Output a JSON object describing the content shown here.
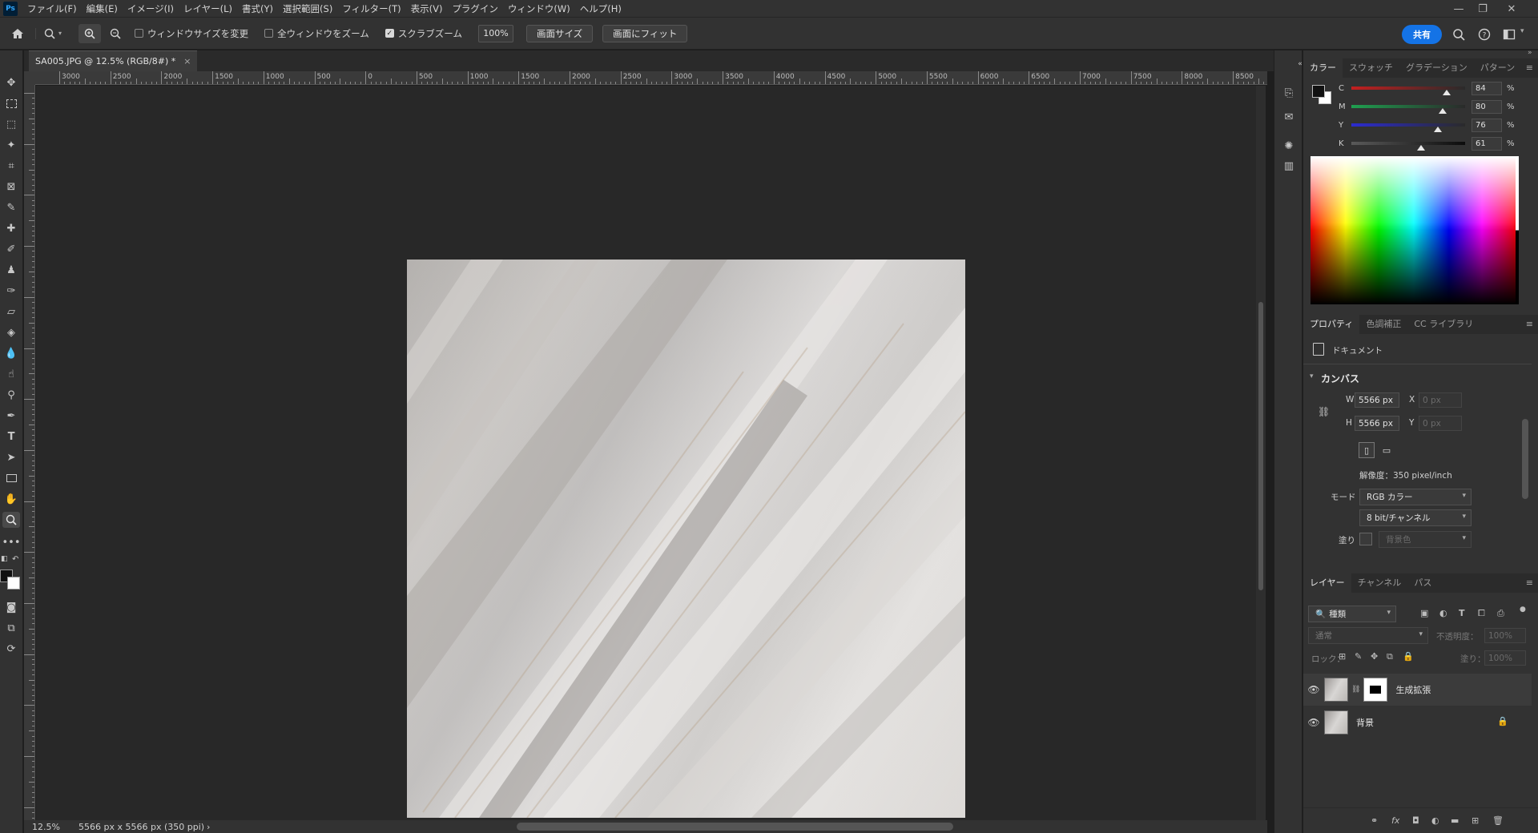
{
  "app": {
    "logo": "Ps"
  },
  "menu": [
    "ファイル(F)",
    "編集(E)",
    "イメージ(I)",
    "レイヤー(L)",
    "書式(Y)",
    "選択範囲(S)",
    "フィルター(T)",
    "表示(V)",
    "プラグイン",
    "ウィンドウ(W)",
    "ヘルプ(H)"
  ],
  "window_controls": {
    "minimize": "—",
    "restore": "❐",
    "close": "✕"
  },
  "options": {
    "resize_windows": {
      "label": "ウィンドウサイズを変更",
      "checked": false
    },
    "zoom_all": {
      "label": "全ウィンドウをズーム",
      "checked": false
    },
    "scrubby_zoom": {
      "label": "スクラブズーム",
      "checked": true
    },
    "zoom_value": "100%",
    "fill_screen_btn": "画面サイズ",
    "fit_screen_btn": "画面にフィット",
    "share": "共有"
  },
  "document": {
    "tab_title": "SA005.JPG @ 12.5% (RGB/8#) *",
    "close": "×"
  },
  "ruler_h_labels": [
    "3000",
    "2500",
    "2000",
    "1500",
    "1000",
    "500",
    "0",
    "500",
    "1000",
    "1500",
    "2000",
    "2500",
    "3000",
    "3500",
    "4000",
    "4500",
    "5000",
    "5500",
    "6000",
    "6500",
    "7000",
    "7500",
    "8000",
    "8500"
  ],
  "status": {
    "zoom": "12.5%",
    "info": "5566 px x 5566 px (350 ppi)",
    "arrow": "›"
  },
  "color_panel": {
    "tabs": [
      "カラー",
      "スウォッチ",
      "グラデーション",
      "パターン"
    ],
    "sliders": [
      {
        "label": "C",
        "value": "84",
        "unit": "%",
        "level": 0.84
      },
      {
        "label": "M",
        "value": "80",
        "unit": "%",
        "level": 0.8
      },
      {
        "label": "Y",
        "value": "76",
        "unit": "%",
        "level": 0.76
      },
      {
        "label": "K",
        "value": "61",
        "unit": "%",
        "level": 0.61
      }
    ]
  },
  "properties_panel": {
    "tabs": [
      "プロパティ",
      "色調補正",
      "CC ライブラリ"
    ],
    "doc_label": "ドキュメント",
    "section": "カンバス",
    "w_label": "W",
    "w_value": "5566 px",
    "h_label": "H",
    "h_value": "5566 px",
    "x_label": "X",
    "x_value": "0 px",
    "y_label": "Y",
    "y_value": "0 px",
    "resolution": "解像度：350 pixel/inch",
    "mode_label": "モード",
    "mode_value": "RGB カラー",
    "depth_value": "8 bit/チャンネル",
    "fill_label": "塗り",
    "fill_value": "背景色"
  },
  "layers_panel": {
    "tabs": [
      "レイヤー",
      "チャンネル",
      "パス"
    ],
    "filter_value": "種類",
    "blend_mode": "通常",
    "opacity_label": "不透明度：",
    "opacity_value": "100%",
    "lock_label": "ロック：",
    "fill_label": "塗り：",
    "fill_value": "100%",
    "layers": [
      {
        "name": "生成拡張",
        "visible": true,
        "locked": false,
        "has_mask": true
      },
      {
        "name": "背景",
        "visible": true,
        "locked": true,
        "has_mask": false
      }
    ]
  }
}
